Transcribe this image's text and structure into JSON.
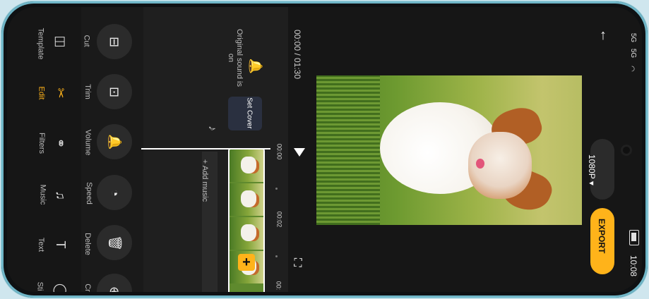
{
  "tabs": [
    {
      "label": "Template",
      "icon": "template-icon"
    },
    {
      "label": "Edit",
      "icon": "scissors-icon",
      "active": true
    },
    {
      "label": "Filters",
      "icon": "filters-icon"
    },
    {
      "label": "Music",
      "icon": "music-icon"
    },
    {
      "label": "Text",
      "icon": "text-icon"
    },
    {
      "label": "Sti",
      "icon": "sticker-icon"
    }
  ],
  "tools": [
    {
      "label": "Cut"
    },
    {
      "label": "Trim"
    },
    {
      "label": "Volume"
    },
    {
      "label": "Speed"
    },
    {
      "label": "Delete"
    },
    {
      "label": "Cr"
    }
  ],
  "timeline": {
    "sound_status": "Original sound is on",
    "set_cover": "Set Cover",
    "add_music": "+ Add music",
    "time_marks": [
      "00:00",
      "00:02",
      "00:"
    ]
  },
  "preview": {
    "time": "00:00 / 01:30",
    "quality": "1080P ▾",
    "export": "EXPORT"
  },
  "status_bar": {
    "clock": "10:08",
    "signal1": "5G",
    "signal2": "5G"
  },
  "accent_color": "#ffb31a"
}
